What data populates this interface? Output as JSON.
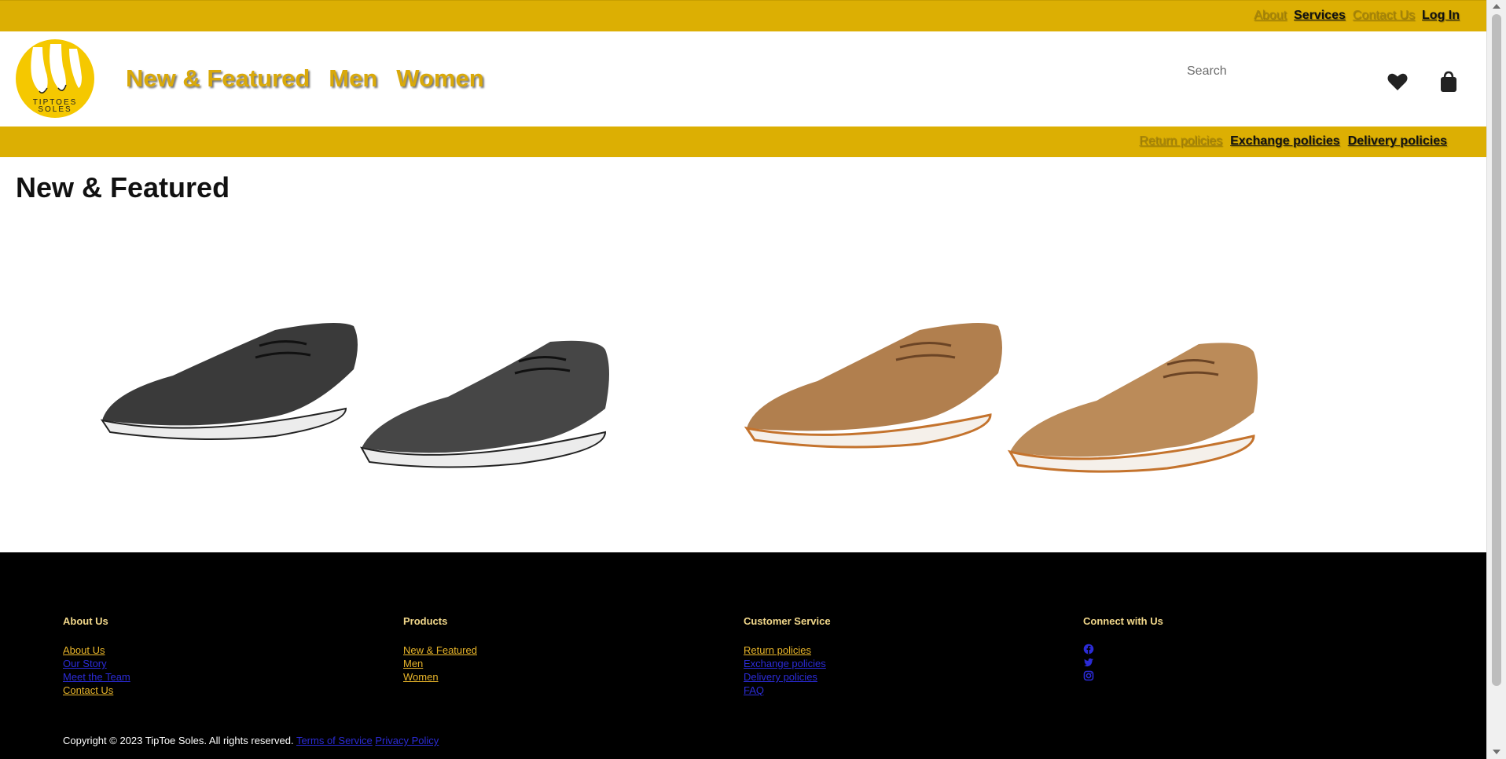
{
  "topbar": {
    "links": [
      {
        "label": "About"
      },
      {
        "label": "Services"
      },
      {
        "label": "Contact Us"
      },
      {
        "label": "Log In"
      }
    ]
  },
  "header": {
    "logo": {
      "line1": "TIPTOES",
      "line2": "SOLES"
    },
    "nav": [
      {
        "label": "New & Featured"
      },
      {
        "label": "Men"
      },
      {
        "label": "Women"
      }
    ],
    "search": {
      "placeholder": "Search",
      "value": ""
    },
    "icons": {
      "wishlist": "heart-icon",
      "cart": "shopping-bag-icon"
    }
  },
  "policies_bar": {
    "links": [
      {
        "label": "Return policies"
      },
      {
        "label": "Exchange policies"
      },
      {
        "label": "Delivery policies"
      }
    ]
  },
  "main": {
    "title": "New & Featured",
    "products": [
      {
        "image": "black-suede-shoes",
        "color": "#3a3a3a"
      },
      {
        "image": "tan-suede-shoes",
        "color": "#b17f4e"
      }
    ]
  },
  "footer": {
    "columns": [
      {
        "heading": "About Us",
        "links": [
          "About Us",
          "Our Story",
          "Meet the Team",
          "Contact Us"
        ]
      },
      {
        "heading": "Products",
        "links": [
          "New & Featured",
          "Men",
          "Women"
        ]
      },
      {
        "heading": "Customer Service",
        "links": [
          "Return policies",
          "Exchange policies",
          "Delivery policies",
          "FAQ"
        ]
      },
      {
        "heading": "Connect with Us",
        "icons": [
          "facebook-icon",
          "twitter-icon",
          "instagram-icon"
        ]
      }
    ],
    "copyright": "Copyright © 2023 TipToe Soles. All rights reserved.",
    "legal_links": [
      "Terms of Service",
      "Privacy Policy"
    ]
  },
  "colors": {
    "brand_gold": "#dcaf03",
    "nav_gold": "#d9a90a",
    "footer_bg": "#000000",
    "link_blue": "#2b2bd6"
  }
}
